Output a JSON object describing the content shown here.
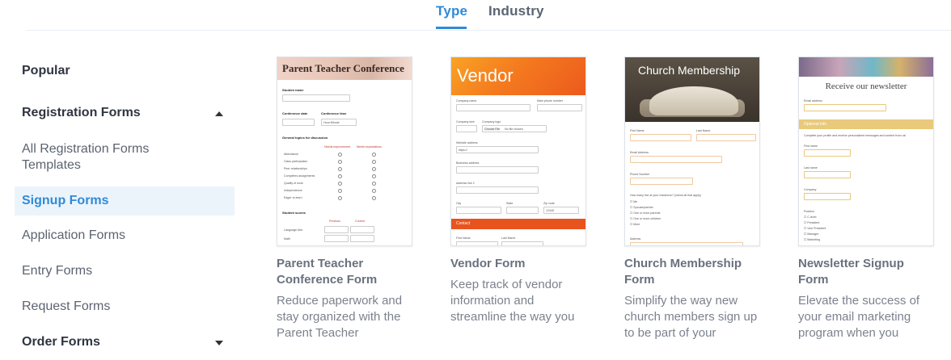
{
  "tabs": {
    "type": "Type",
    "industry": "Industry"
  },
  "sidebar": {
    "popular": "Popular",
    "registration_forms": "Registration Forms",
    "all_registration": "All Registration Forms Templates",
    "signup_forms": "Signup Forms",
    "application_forms": "Application Forms",
    "entry_forms": "Entry Forms",
    "request_forms": "Request Forms",
    "order_forms": "Order Forms"
  },
  "accent_color": "#2e8bd8",
  "cards": [
    {
      "title": "Parent Teacher Conference Form",
      "description": "Reduce paperwork and stay organized with the Parent Teacher",
      "thumb": {
        "heading": "Parent Teacher Conference",
        "student_name": "Student name",
        "conference_date": "Conference date",
        "conference_time": "Conference time",
        "time_placeholder": "Hour:Minute",
        "topics": "General topics for discussion",
        "needs_improvement": "Needs improvement",
        "meets_expectations": "Meets expectations",
        "rows": [
          "Attendance",
          "Class participation",
          "Peer relationships",
          "Completes assignments",
          "Quality of work",
          "Independence",
          "Eager to learn"
        ],
        "student_scores": "Student scores",
        "previous": "Previous",
        "current": "Current",
        "score_rows": [
          "Language Arts",
          "Math"
        ]
      }
    },
    {
      "title": "Vendor Form",
      "description": "Keep track of vendor information and streamline the way you",
      "thumb": {
        "heading": "Vendor",
        "company_name": "Company name",
        "main_phone": "Main phone number",
        "company_size": "Company size",
        "company_logo": "Company logo",
        "choose_file": "Choose File",
        "no_file": "No file chosen",
        "website": "Website address",
        "website_placeholder": "https://",
        "business_address": "Business address",
        "address_line_2": "Address line 2",
        "city": "City",
        "state": "State",
        "zip": "Zip code",
        "zip_placeholder": "12345",
        "contact": "Contact",
        "first_name": "First Name",
        "last_name": "Last Name"
      }
    },
    {
      "title": "Church Membership Form",
      "description": "Simplify the way new church members sign up to be part of your",
      "thumb": {
        "heading": "Church Membership",
        "first_name": "First Name",
        "last_name": "Last Name",
        "email": "Email Address",
        "phone": "Phone Number",
        "household_q": "How many live at your residence? (check all that apply)",
        "options": [
          "Me",
          "Spouse/partner",
          "One or more parents",
          "One or more children",
          "More"
        ],
        "address": "Address"
      }
    },
    {
      "title": "Newsletter Signup Form",
      "description": "Elevate the success of your email marketing program when you",
      "thumb": {
        "heading": "Receive our newsletter",
        "email": "Email address",
        "optional_info": "Optional info",
        "optional_desc": "Complete your profile and receive personalized messages and content from us!",
        "first_name": "First name",
        "last_name": "Last name",
        "company": "Company",
        "position": "Position",
        "positions": [
          "C-level",
          "President",
          "Vice President",
          "Manager",
          "Marketing"
        ]
      }
    }
  ]
}
